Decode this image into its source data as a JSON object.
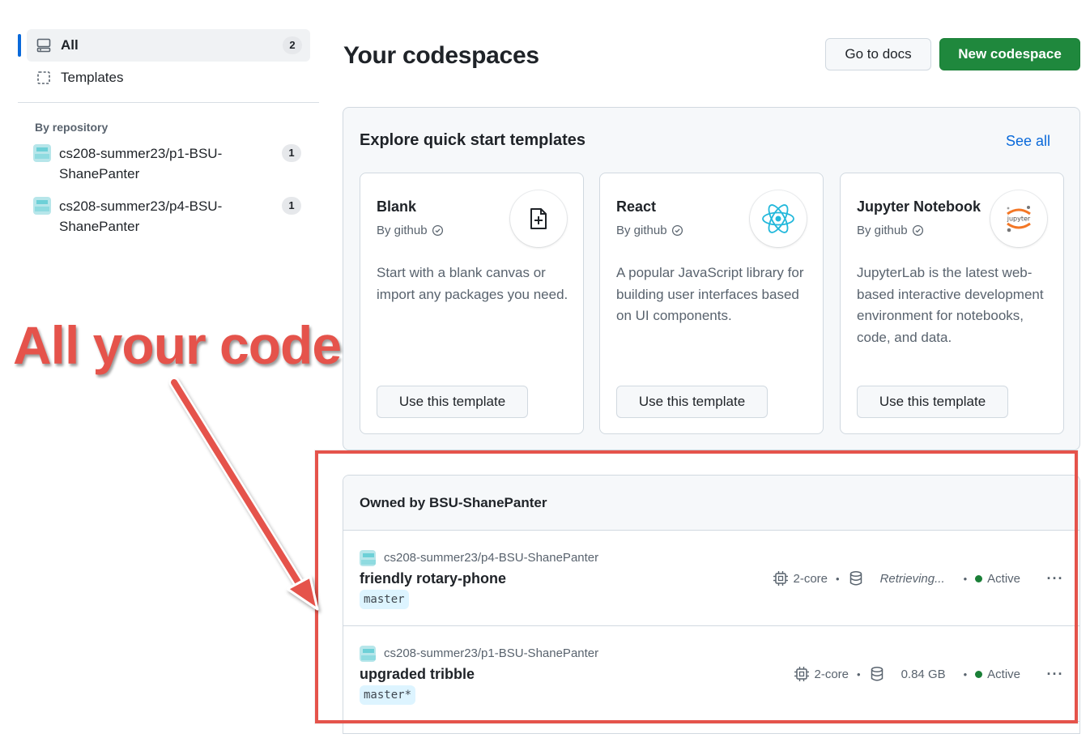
{
  "sidebar": {
    "items": [
      {
        "label": "All",
        "count": "2",
        "icon": "codespaces-icon"
      },
      {
        "label": "Templates",
        "icon": "template-icon"
      }
    ],
    "repo_heading": "By repository",
    "repos": [
      {
        "label": "cs208-summer23/p1-BSU-ShanePanter",
        "count": "1"
      },
      {
        "label": "cs208-summer23/p4-BSU-ShanePanter",
        "count": "1"
      }
    ]
  },
  "header": {
    "title": "Your codespaces",
    "docs_label": "Go to docs",
    "new_label": "New codespace"
  },
  "templates": {
    "title": "Explore quick start templates",
    "see_all": "See all",
    "cards": [
      {
        "name": "Blank",
        "by": "By github",
        "desc": "Start with a blank canvas or import any packages you need.",
        "button": "Use this template",
        "icon": "file-add-icon"
      },
      {
        "name": "React",
        "by": "By github",
        "desc": "A popular JavaScript library for building user interfaces based on UI components.",
        "button": "Use this template",
        "icon": "react-icon"
      },
      {
        "name": "Jupyter Notebook",
        "by": "By github",
        "desc": "JupyterLab is the latest web-based interactive development environment for notebooks, code, and data.",
        "button": "Use this template",
        "icon": "jupyter-icon",
        "logo_text": "jupyter"
      }
    ]
  },
  "owned": {
    "title": "Owned by BSU-ShanePanter",
    "codespaces": [
      {
        "repo": "cs208-summer23/p4-BSU-ShanePanter",
        "name": "friendly rotary-phone",
        "branch": "master",
        "cores": "2-core",
        "storage": "Retrieving...",
        "status": "Active",
        "more": "···"
      },
      {
        "repo": "cs208-summer23/p1-BSU-ShanePanter",
        "name": "upgraded tribble",
        "branch": "master*",
        "cores": "2-core",
        "storage": "0.84 GB",
        "status": "Active",
        "more": "···"
      }
    ]
  },
  "annotation": {
    "text": "All your code",
    "color": "#e5534b"
  },
  "colors": {
    "accent": "#0969da",
    "primary_button": "#1f883d",
    "active_status": "#1a7f37"
  }
}
